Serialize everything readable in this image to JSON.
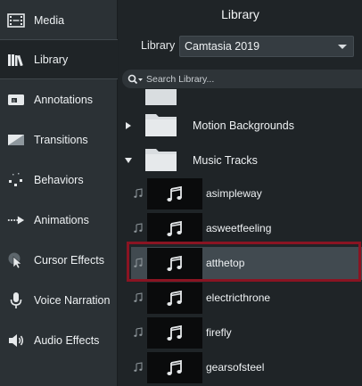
{
  "sidebar": {
    "items": [
      {
        "label": "Media",
        "icon": "film-strip-icon"
      },
      {
        "label": "Library",
        "icon": "books-icon",
        "active": true
      },
      {
        "label": "Annotations",
        "icon": "annotation-icon"
      },
      {
        "label": "Transitions",
        "icon": "transition-icon"
      },
      {
        "label": "Behaviors",
        "icon": "behaviors-icon"
      },
      {
        "label": "Animations",
        "icon": "animation-arrow-icon"
      },
      {
        "label": "Cursor Effects",
        "icon": "cursor-icon"
      },
      {
        "label": "Voice Narration",
        "icon": "microphone-icon"
      },
      {
        "label": "Audio Effects",
        "icon": "speaker-icon"
      }
    ]
  },
  "main": {
    "title": "Library",
    "library_label": "Library",
    "library_selected": "Camtasia 2019",
    "search_placeholder": "Search Library...",
    "folders": [
      {
        "label": "Motion Backgrounds",
        "expanded": false
      },
      {
        "label": "Music Tracks",
        "expanded": true
      }
    ],
    "tracks": [
      {
        "label": "asimpleway"
      },
      {
        "label": "asweetfeeling"
      },
      {
        "label": "atthetop",
        "selected": true
      },
      {
        "label": "electricthrone"
      },
      {
        "label": "firefly"
      },
      {
        "label": "gearsofsteel"
      }
    ]
  },
  "colors": {
    "sidebar_bg": "#2b3135",
    "panel_bg": "#1f2427",
    "selected_row": "#414a50",
    "highlight_border": "#8a1422"
  }
}
